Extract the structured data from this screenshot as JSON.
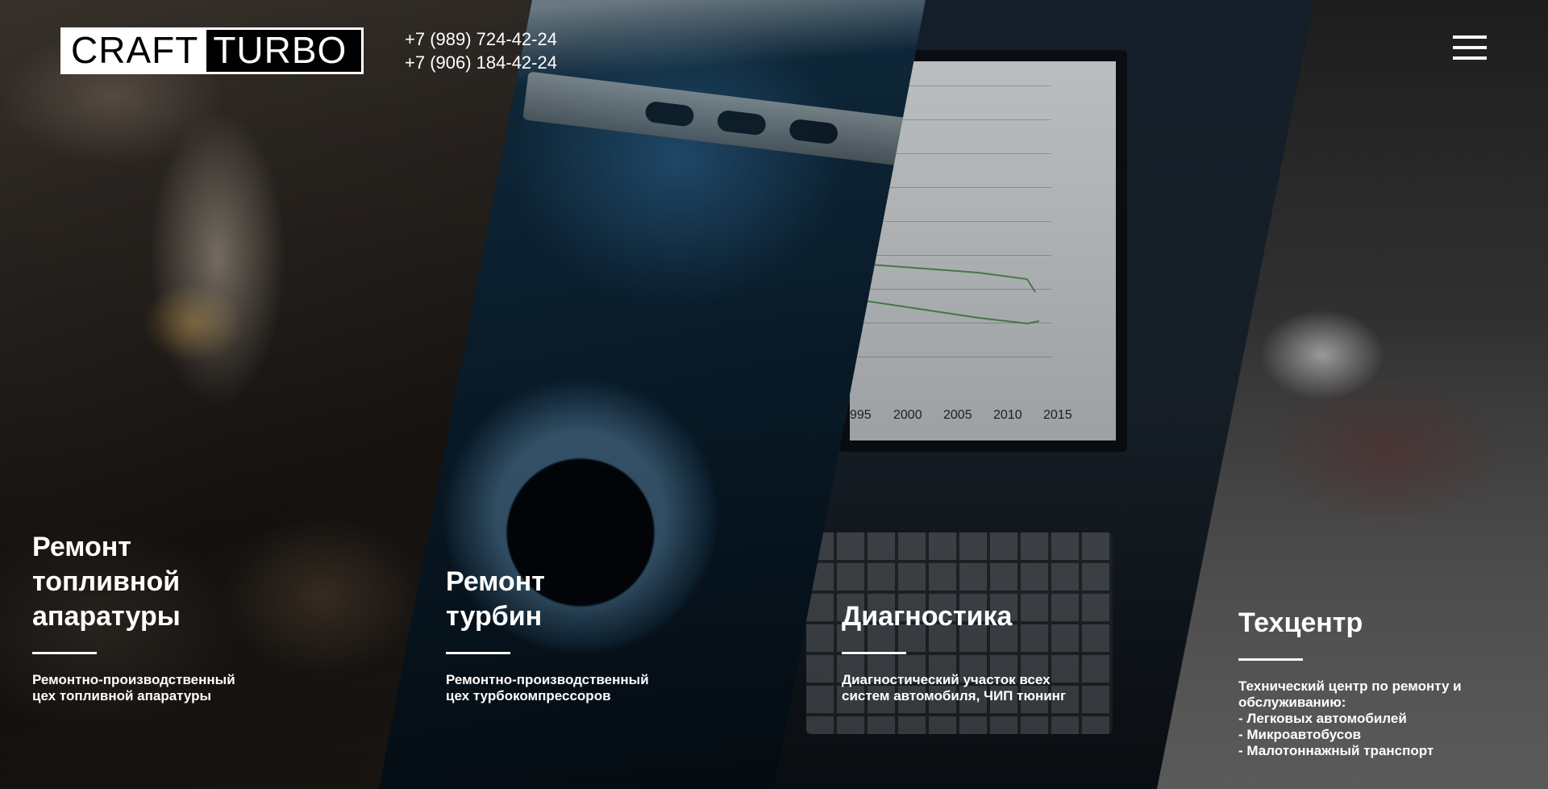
{
  "header": {
    "logo": {
      "part1": "CRAFT",
      "part2": "TURBO"
    },
    "phones": [
      "+7 (989) 724-42-24",
      "+7 (906) 184-42-24"
    ],
    "menu_icon": "hamburger-menu-icon"
  },
  "screen_chart": {
    "x_ticks": [
      "995",
      "2000",
      "2005",
      "2010",
      "2015"
    ]
  },
  "services": [
    {
      "title_lines": [
        "Ремонт",
        "топливной",
        "апаратуры"
      ],
      "description_lines": [
        "Ремонтно-производственный",
        "цех топливной апаратуры"
      ]
    },
    {
      "title_lines": [
        "Ремонт",
        "турбин"
      ],
      "description_lines": [
        "Ремонтно-производственный",
        "цех турбокомпрессоров"
      ]
    },
    {
      "title_lines": [
        "Диагностика"
      ],
      "description_lines": [
        "Диагностический участок всех",
        "систем автомобиля, ЧИП тюнинг"
      ]
    },
    {
      "title_lines": [
        "Техцентр"
      ],
      "description_lines": [
        "Технический центр по ремонту и",
        "обслуживанию:",
        "- Легковых автомобилей",
        "- Микроавтобусов",
        "- Малотоннажный транспорт"
      ]
    }
  ]
}
